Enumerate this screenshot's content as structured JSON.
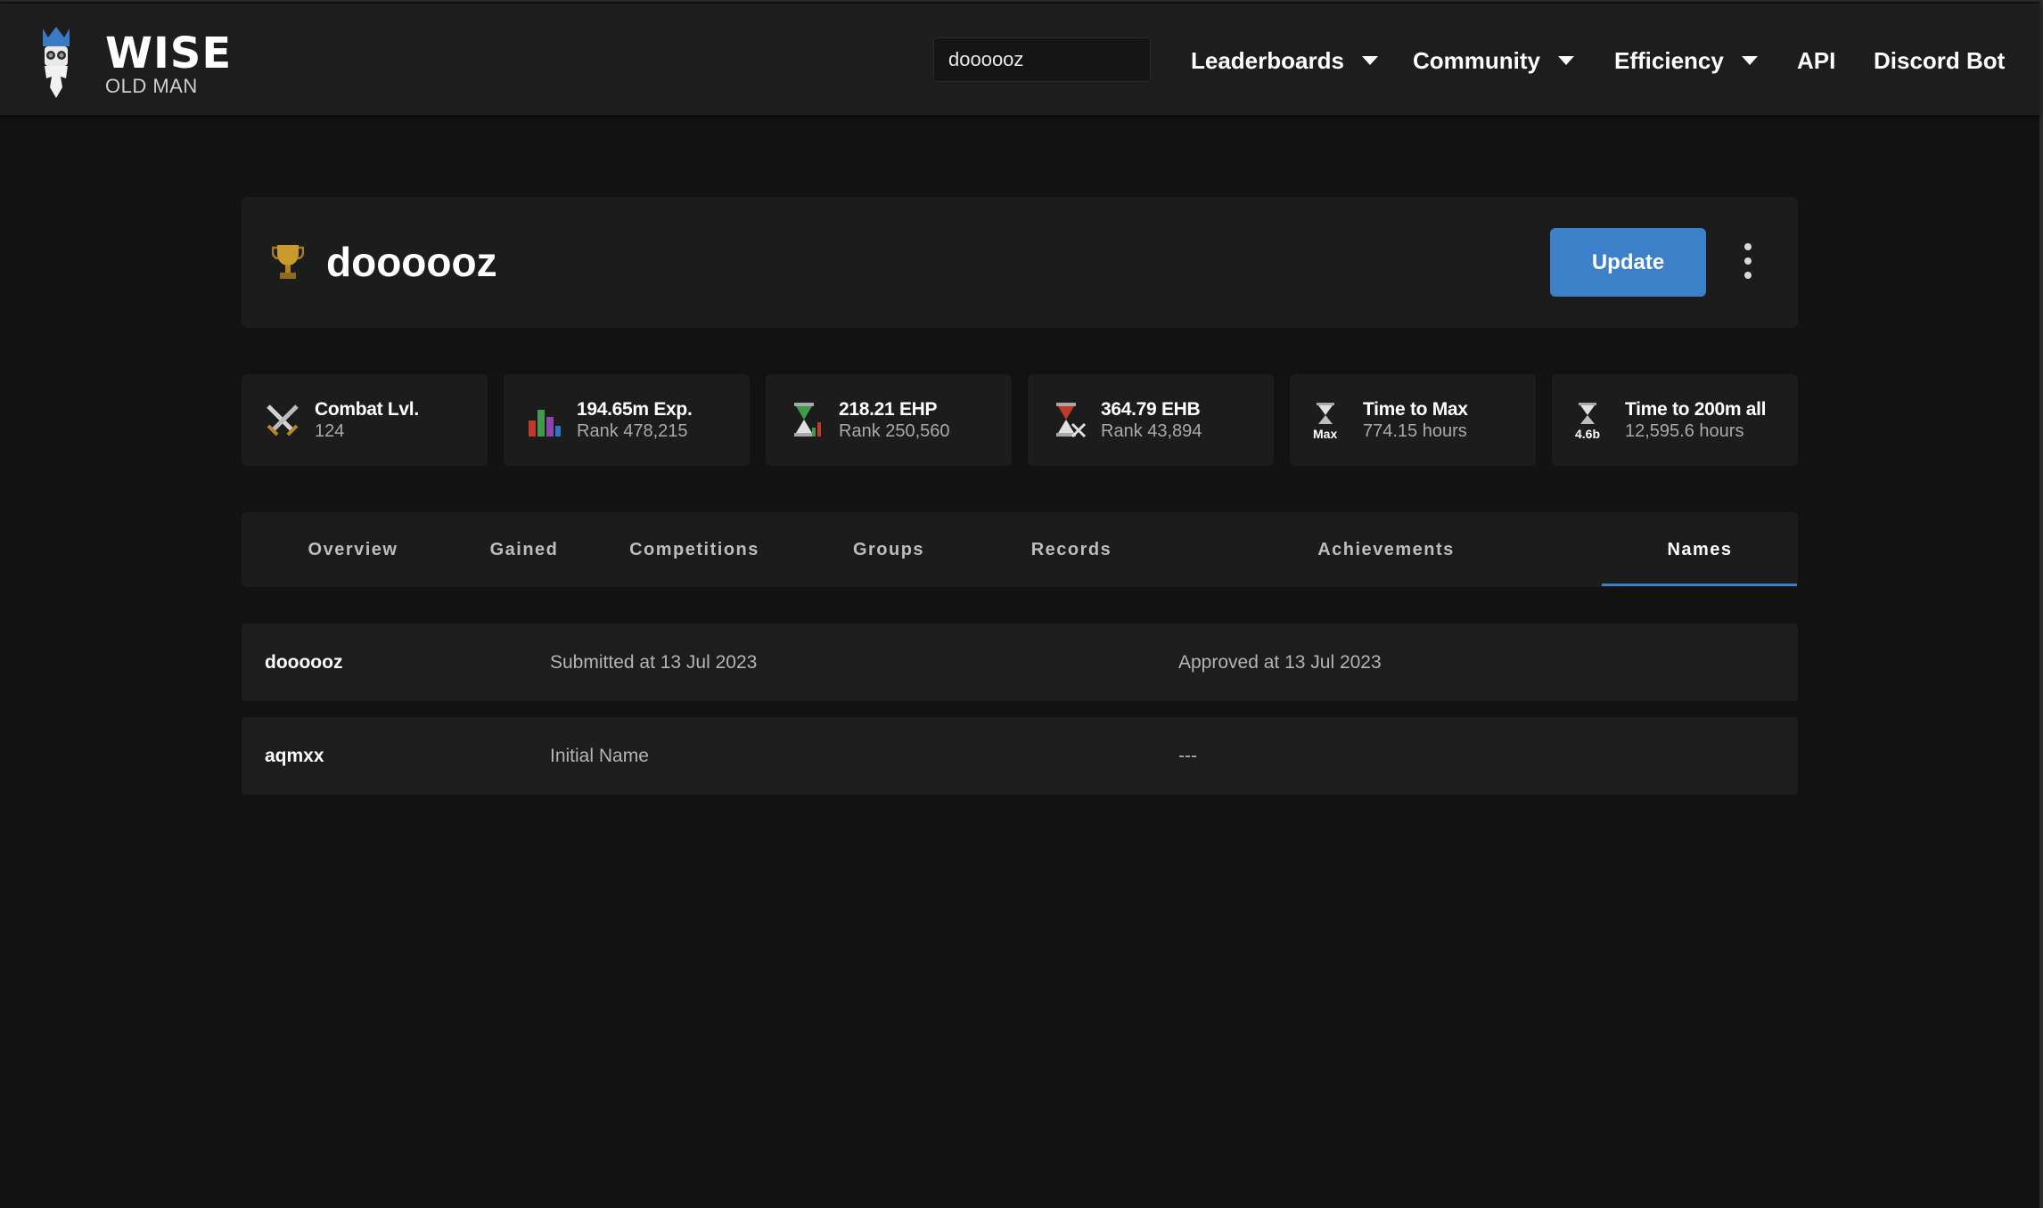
{
  "header": {
    "logo": {
      "title": "WISE",
      "subtitle": "OLD MAN"
    },
    "search": {
      "value": "doooooz"
    },
    "nav": [
      {
        "label": "Leaderboards",
        "dropdown": true
      },
      {
        "label": "Community",
        "dropdown": true
      },
      {
        "label": "Efficiency",
        "dropdown": true
      },
      {
        "label": "API",
        "dropdown": false
      },
      {
        "label": "Discord Bot",
        "dropdown": false
      }
    ]
  },
  "player": {
    "name": "doooooz",
    "update_label": "Update",
    "icon": "trophy-icon"
  },
  "stats": [
    {
      "icon": "crossed-swords-icon",
      "title": "Combat Lvl.",
      "subtitle": "124"
    },
    {
      "icon": "bar-chart-icon",
      "title": "194.65m Exp.",
      "subtitle": "Rank 478,215"
    },
    {
      "icon": "hourglass-ehp-icon",
      "title": "218.21 EHP",
      "subtitle": "Rank 250,560"
    },
    {
      "icon": "hourglass-ehb-icon",
      "title": "364.79 EHB",
      "subtitle": "Rank 43,894"
    },
    {
      "icon": "hourglass-max-icon",
      "icon_text": "Max",
      "title": "Time to Max",
      "subtitle": "774.15 hours"
    },
    {
      "icon": "hourglass-200m-icon",
      "icon_text": "4.6b",
      "title": "Time to 200m all",
      "subtitle": "12,595.6 hours"
    }
  ],
  "tabs": [
    {
      "label": "Overview",
      "active": false
    },
    {
      "label": "Gained",
      "active": false
    },
    {
      "label": "Competitions",
      "active": false
    },
    {
      "label": "Groups",
      "active": false
    },
    {
      "label": "Records",
      "active": false
    },
    {
      "label": "Achievements",
      "active": false
    },
    {
      "label": "Names",
      "active": true
    }
  ],
  "names": [
    {
      "name": "doooooz",
      "submitted": "Submitted at 13 Jul 2023",
      "approved": "Approved at 13 Jul 2023"
    },
    {
      "name": "aqmxx",
      "submitted": "Initial Name",
      "approved": "---"
    }
  ],
  "colors": {
    "background": "#121212",
    "surface": "#1c1c1c",
    "accent": "#3b80c8",
    "text_muted": "#a9a9a9"
  }
}
